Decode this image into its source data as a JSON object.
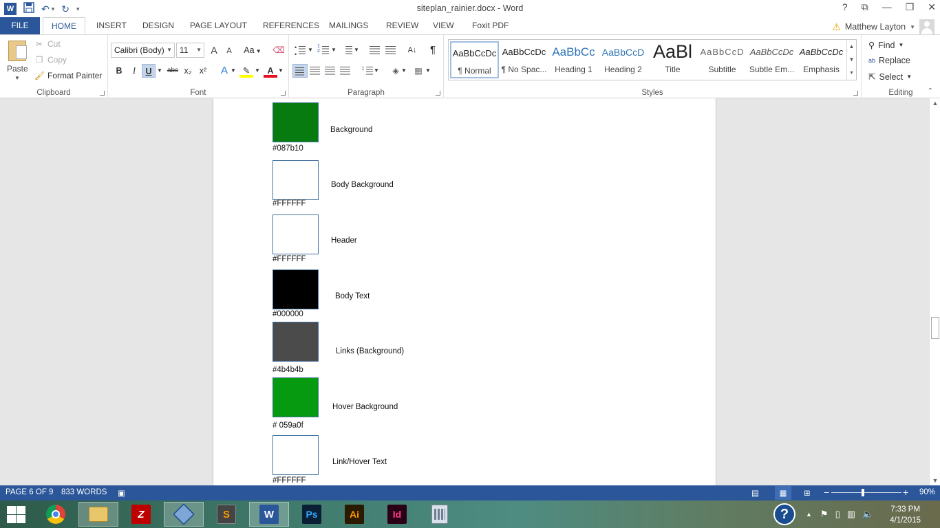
{
  "window": {
    "title": "siteplan_rainier.docx - Word",
    "help": "?",
    "restore_ribbon": "⧉",
    "minimize": "—",
    "maximize": "❐",
    "close": "✕"
  },
  "qat": {
    "app_icon": "W",
    "save_icon": "save-icon",
    "undo_icon": "undo-icon",
    "redo_icon": "redo-icon"
  },
  "tabs": [
    "FILE",
    "HOME",
    "INSERT",
    "DESIGN",
    "PAGE LAYOUT",
    "REFERENCES",
    "MAILINGS",
    "REVIEW",
    "VIEW",
    "Foxit PDF"
  ],
  "user": {
    "name": "Matthew Layton"
  },
  "clipboard": {
    "paste": "Paste",
    "cut": "Cut",
    "copy": "Copy",
    "format_painter": "Format Painter",
    "label": "Clipboard"
  },
  "font": {
    "font_name": "Calibri (Body)",
    "font_size": "11",
    "grow": "A",
    "shrink": "A",
    "case": "Aa",
    "bold": "B",
    "italic": "I",
    "underline": "U",
    "strike": "abc",
    "sub": "x₂",
    "sup": "x²",
    "effects": "A",
    "font_color": "A",
    "label": "Font"
  },
  "paragraph": {
    "label": "Paragraph",
    "pilcrow": "¶"
  },
  "styles": {
    "items": [
      {
        "sample": "AaBbCcDc",
        "name": "¶ Normal"
      },
      {
        "sample": "AaBbCcDc",
        "name": "¶ No Spac..."
      },
      {
        "sample": "AaBbCc",
        "name": "Heading 1"
      },
      {
        "sample": "AaBbCcD",
        "name": "Heading 2"
      },
      {
        "sample": "AaBl",
        "name": "Title"
      },
      {
        "sample": "AaBbCcD",
        "name": "Subtitle"
      },
      {
        "sample": "AaBbCcDc",
        "name": "Subtle Em..."
      },
      {
        "sample": "AaBbCcDc",
        "name": "Emphasis"
      }
    ],
    "label": "Styles"
  },
  "editing": {
    "find": "Find",
    "replace": "Replace",
    "select": "Select",
    "label": "Editing"
  },
  "document": {
    "colors": [
      {
        "hex": "#087b10",
        "label": "Background",
        "color": "#087b10"
      },
      {
        "hex": "#FFFFFF",
        "label": "Body Background",
        "color": "#ffffff"
      },
      {
        "hex": "#FFFFFF",
        "label": "Header",
        "color": "#ffffff"
      },
      {
        "hex": "#000000",
        "label": "Body Text",
        "color": "#000000"
      },
      {
        "hex": "#4b4b4b",
        "label": "Links (Background)",
        "color": "#4b4b4b"
      },
      {
        "hex": "# 059a0f",
        "label": "Hover Background",
        "color": "#059a0f"
      },
      {
        "hex": "#FFFFFF",
        "label": "Link/Hover Text",
        "color": "#ffffff"
      }
    ]
  },
  "status": {
    "page": "PAGE 6 OF 9",
    "words": "833 WORDS",
    "zoom_minus": "−",
    "zoom_plus": "+",
    "zoom": "90%"
  },
  "taskbar": {
    "apps": [
      "chrome-icon",
      "file-explorer-icon",
      "filezilla-icon",
      "virtualbox-icon",
      "sublime-text-icon",
      "word-icon",
      "photoshop-icon",
      "illustrator-icon",
      "indesign-icon",
      "calculator-icon"
    ],
    "filezilla": "Z",
    "sublime": "S",
    "word": "W",
    "photoshop": "Ps",
    "illustrator": "Ai",
    "indesign": "Id",
    "time": "7:33 PM",
    "date": "4/1/2015"
  }
}
